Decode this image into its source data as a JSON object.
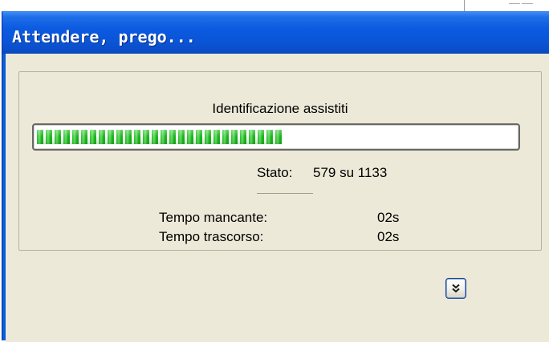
{
  "dialog": {
    "title": "Attendere, prego...",
    "heading": "Identificazione assistiti",
    "progress": {
      "current": 579,
      "total": 1133
    },
    "status": {
      "label": "Stato:",
      "value": "579 su 1133"
    },
    "time_remaining": {
      "label": "Tempo mancante:",
      "value": "02s"
    },
    "time_elapsed": {
      "label": "Tempo trascorso:",
      "value": "02s"
    },
    "expand_button": {
      "icon": "chevron-double-down-icon"
    }
  },
  "colors": {
    "titlebar": "#0a5ed8",
    "client": "#ece9d8",
    "progress_fill": "#28c228"
  }
}
